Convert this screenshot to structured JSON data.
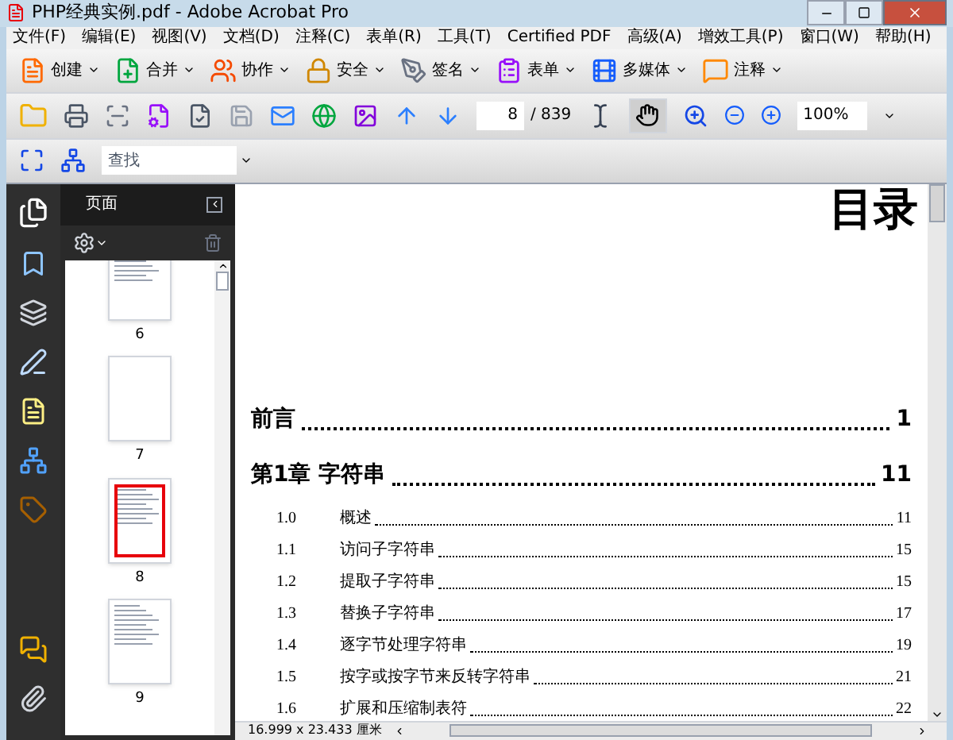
{
  "window": {
    "title": "PHP经典实例.pdf - Adobe Acrobat Pro"
  },
  "menu": [
    "文件(F)",
    "编辑(E)",
    "视图(V)",
    "文档(D)",
    "注释(C)",
    "表单(R)",
    "工具(T)",
    "Certified PDF",
    "高级(A)",
    "增效工具(P)",
    "窗口(W)",
    "帮助(H)"
  ],
  "tasks": [
    {
      "kind": "create",
      "label": "创建"
    },
    {
      "kind": "combine",
      "label": "合并"
    },
    {
      "kind": "collaborate",
      "label": "协作"
    },
    {
      "kind": "secure",
      "label": "安全"
    },
    {
      "kind": "sign",
      "label": "签名"
    },
    {
      "kind": "forms",
      "label": "表单"
    },
    {
      "kind": "multimedia",
      "label": "多媒体"
    },
    {
      "kind": "comment",
      "label": "注释"
    }
  ],
  "page_nav": {
    "current": "8",
    "total": "/ 839"
  },
  "zoom": {
    "value": "100%"
  },
  "find": {
    "placeholder": "查找"
  },
  "panel": {
    "title": "页面",
    "thumbnails": [
      {
        "label": "6",
        "kind": "text",
        "selected": false
      },
      {
        "label": "7",
        "kind": "blank",
        "selected": false
      },
      {
        "label": "8",
        "kind": "text",
        "selected": true
      },
      {
        "label": "9",
        "kind": "text",
        "selected": false
      }
    ]
  },
  "document": {
    "heading": "目录",
    "toc": [
      {
        "kind": "chapter",
        "title": "前言",
        "page": "1"
      },
      {
        "kind": "chapter",
        "title": "第1章 字符串",
        "page": "11"
      },
      {
        "kind": "section",
        "number": "1.0",
        "title": "概述",
        "page": "11"
      },
      {
        "kind": "section",
        "number": "1.1",
        "title": "访问子字符串",
        "page": "15"
      },
      {
        "kind": "section",
        "number": "1.2",
        "title": "提取子字符串",
        "page": "15"
      },
      {
        "kind": "section",
        "number": "1.3",
        "title": "替换子字符串",
        "page": "17"
      },
      {
        "kind": "section",
        "number": "1.4",
        "title": "逐字节处理字符串",
        "page": "19"
      },
      {
        "kind": "section",
        "number": "1.5",
        "title": "按字或按字节来反转字符串",
        "page": "21"
      },
      {
        "kind": "section",
        "number": "1.6",
        "title": "扩展和压缩制表符",
        "page": "22"
      }
    ]
  },
  "status_bar": {
    "page_size": "16.999 x 23.433 厘米"
  }
}
